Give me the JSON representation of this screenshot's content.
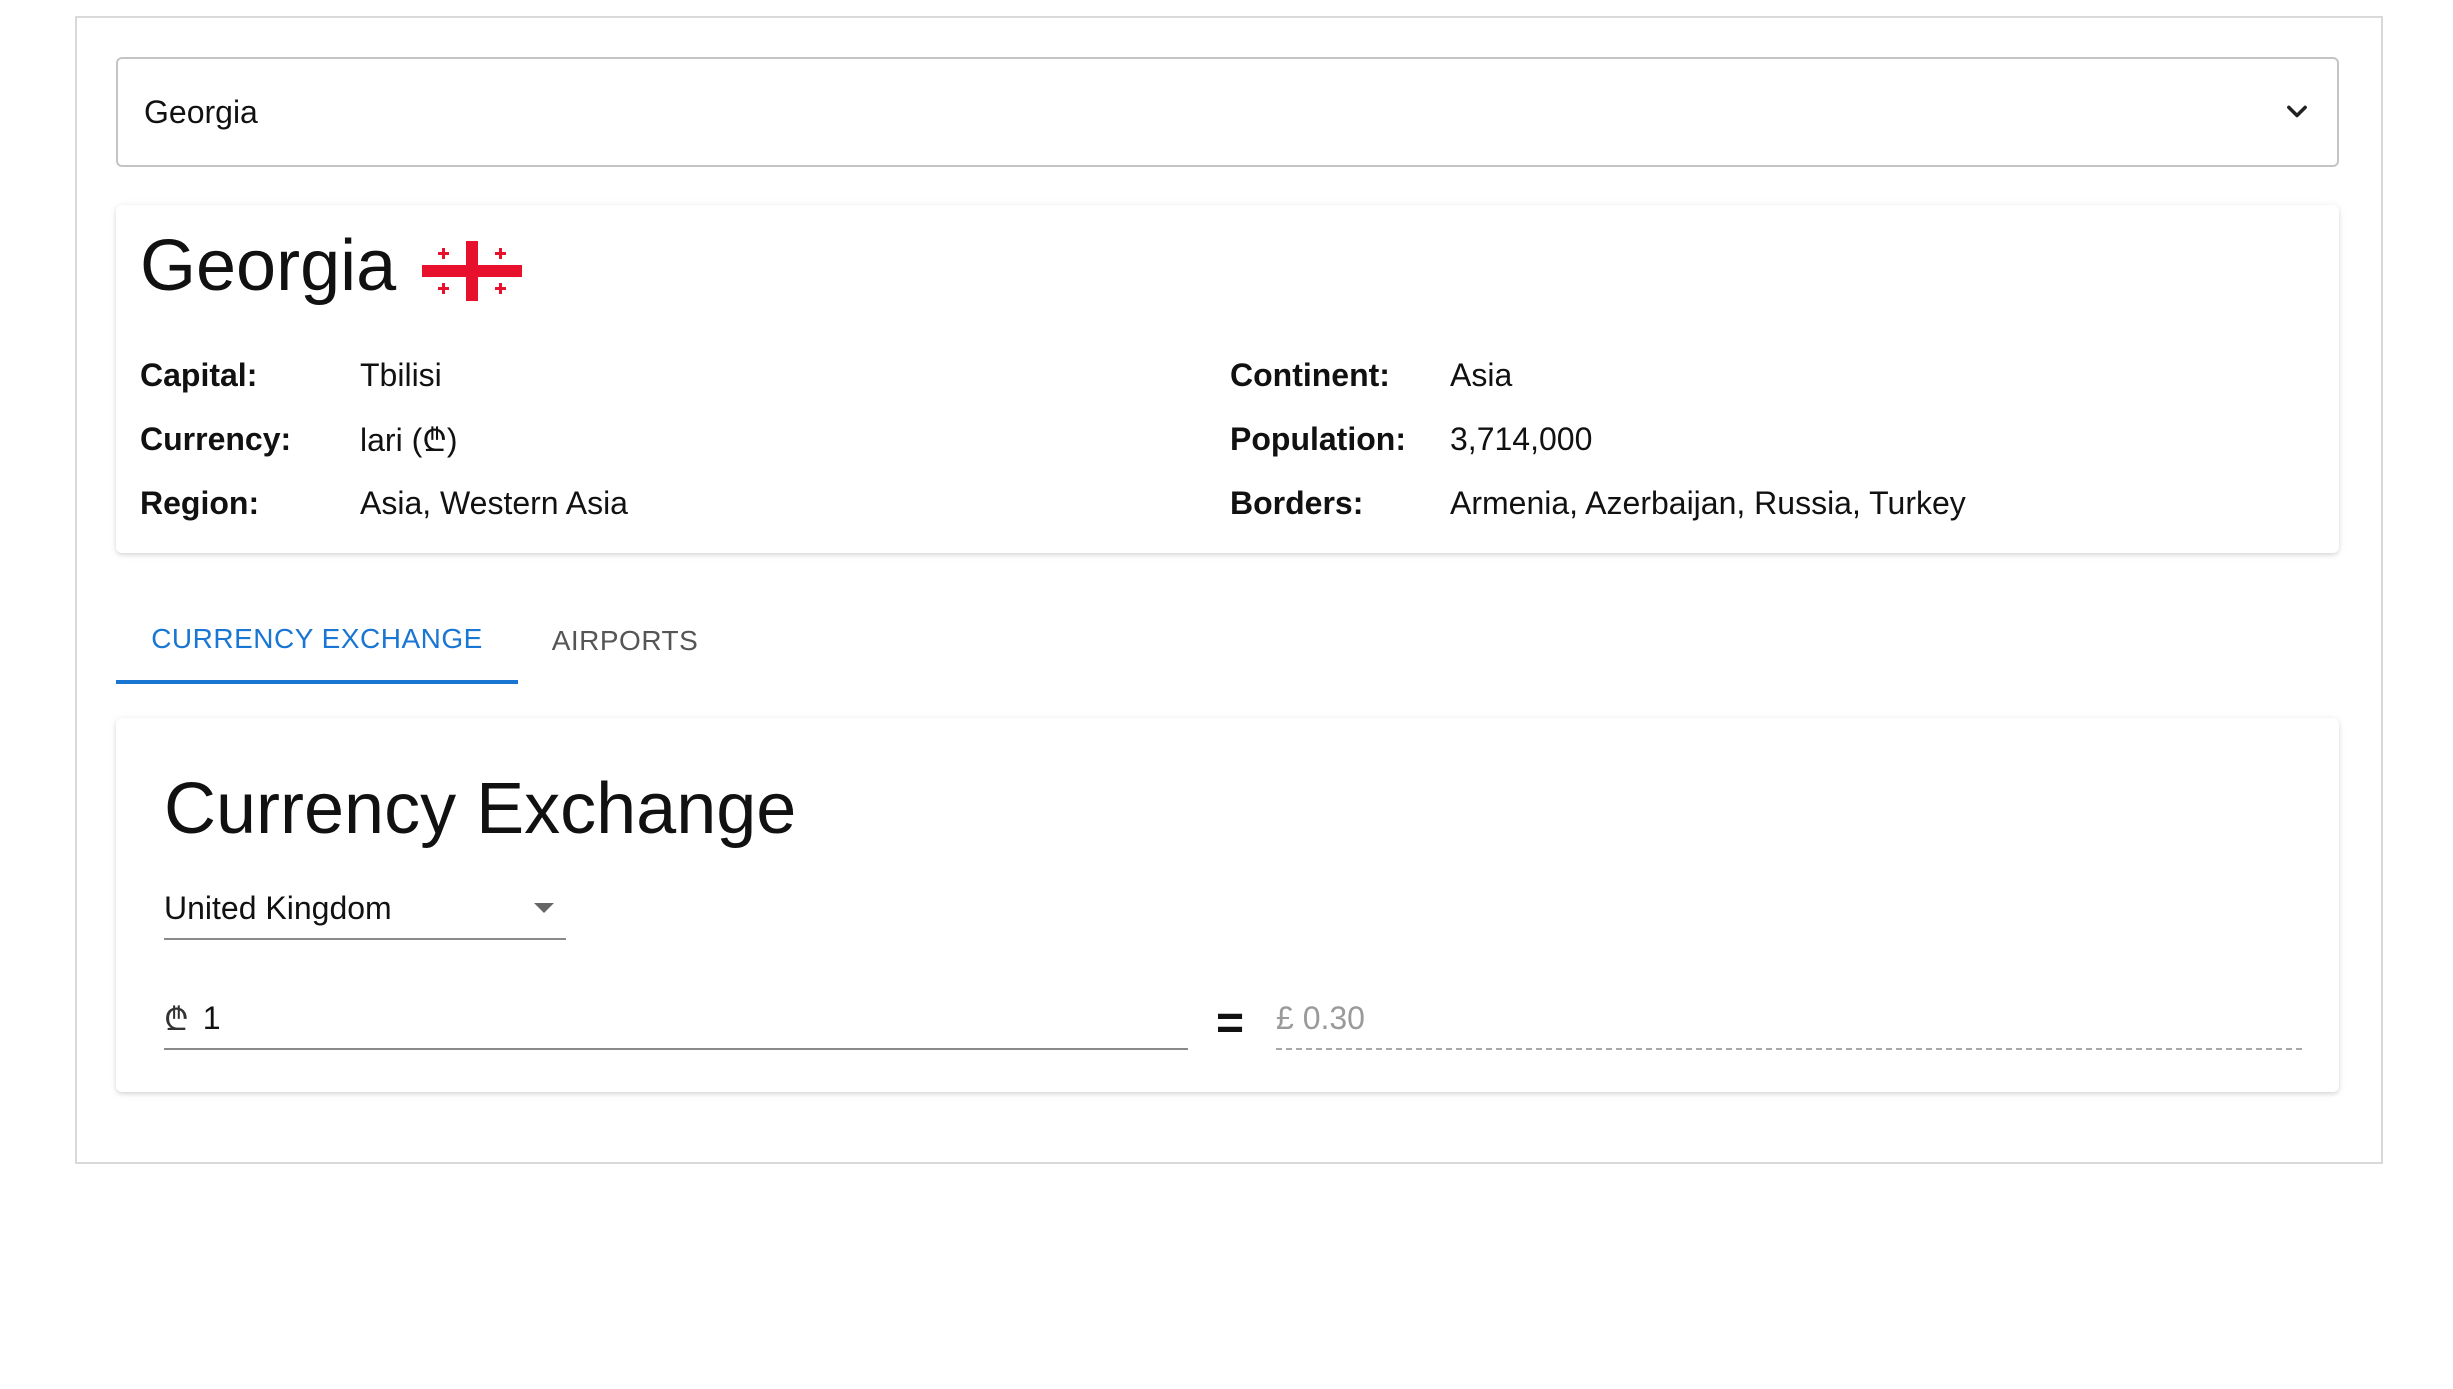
{
  "country_select": {
    "value": "Georgia",
    "icon": "chevron-down-icon"
  },
  "info": {
    "title": "Georgia",
    "flag_icon": "georgia-flag-icon",
    "flag_colors": {
      "cross": "#e8112d",
      "field": "#ffffff"
    },
    "left": [
      {
        "label": "Capital:",
        "value": "Tbilisi"
      },
      {
        "label": "Currency:",
        "value": "lari (₾)"
      },
      {
        "label": "Region:",
        "value": "Asia, Western Asia"
      }
    ],
    "right": [
      {
        "label": "Continent:",
        "value": "Asia"
      },
      {
        "label": "Population:",
        "value": "3,714,000"
      },
      {
        "label": "Borders:",
        "value": "Armenia, Azerbaijan, Russia, Turkey"
      }
    ]
  },
  "tabs": [
    {
      "label": "CURRENCY EXCHANGE",
      "active": true
    },
    {
      "label": "AIRPORTS",
      "active": false
    }
  ],
  "exchange": {
    "title": "Currency Exchange",
    "target_country": "United Kingdom",
    "source_symbol": "₾",
    "amount": "1",
    "equals": "=",
    "result": "£ 0.30"
  },
  "colors": {
    "accent": "#1976d2"
  }
}
